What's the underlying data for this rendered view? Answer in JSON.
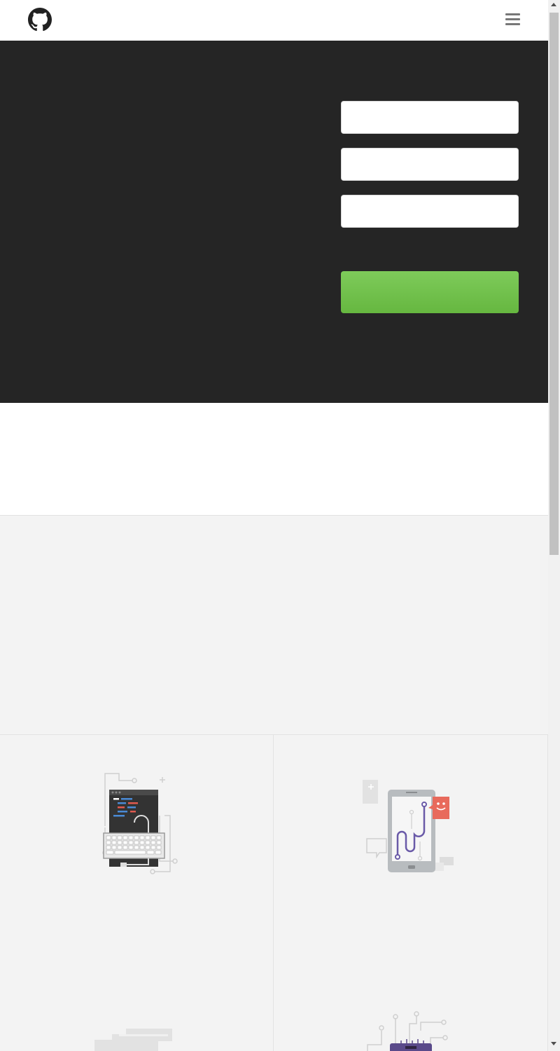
{
  "header": {
    "logo_icon": "github-octocat-icon",
    "menu_icon": "hamburger-menu-icon"
  },
  "hero": {
    "background": "#252525",
    "fields": {
      "username": {
        "value": "",
        "placeholder": ""
      },
      "email": {
        "value": "",
        "placeholder": ""
      },
      "password": {
        "value": "",
        "placeholder": ""
      }
    },
    "signup_button": {
      "label": "",
      "color": "#6cbb4a"
    }
  },
  "features": {
    "items": [
      {
        "icon": "code-keyboard-illustration"
      },
      {
        "icon": "mobile-app-illustration"
      },
      {
        "icon": "server-illustration"
      },
      {
        "icon": "circuit-chip-illustration"
      }
    ]
  },
  "colors": {
    "panel_gray": "#f3f3f3",
    "accent_green": "#6cbb4a"
  }
}
